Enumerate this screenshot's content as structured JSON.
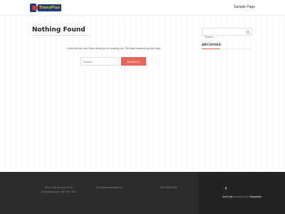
{
  "header": {
    "logo_text": "TransPlus",
    "nav": [
      {
        "label": "Sample Page"
      }
    ]
  },
  "main": {
    "title": "Nothing Found",
    "message": "It seems we can't find what you're looking for. Perhaps searching can help.",
    "search": {
      "placeholder": "Search ...",
      "button_label": "SEARCH"
    }
  },
  "sidebar": {
    "search_placeholder": "Search ...",
    "widget_title": "ARCHIVES"
  },
  "footer": {
    "address_line1": "11401-85 Avenue Fort",
    "address_line2": "Saskatchewan, AB T8L 0A9",
    "email": "tom@transplusltd.ca",
    "phone": "780-998-3550",
    "social_icon": "f",
    "credit_prefix": "Zerif Lite",
    "credit_suffix": " developed by ",
    "credit_author": "ThemeIsle"
  }
}
